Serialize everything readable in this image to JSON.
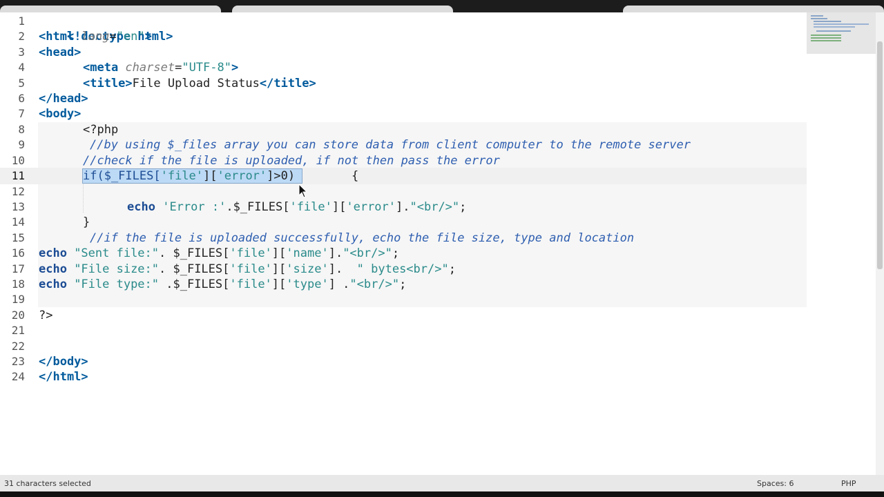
{
  "gutter": [
    "1",
    "2",
    "3",
    "4",
    "5",
    "6",
    "7",
    "8",
    "9",
    "10",
    "11",
    "12",
    "13",
    "14",
    "15",
    "16",
    "17",
    "18",
    "19",
    "20",
    "21",
    "22",
    "23",
    "24"
  ],
  "code": {
    "l1": "<!doctype html>",
    "l2_open": "<html ",
    "l2_attr": "lang",
    "l2_eq": "=",
    "l2_val": "\"en\"",
    "l2_close": ">",
    "l3": "<head>",
    "l4_open": "<meta ",
    "l4_attr": "charset",
    "l4_eq": "=",
    "l4_val": "\"UTF-8\"",
    "l4_close": ">",
    "l5_open": "<title>",
    "l5_text": "File Upload Status",
    "l5_close": "</title>",
    "l6": "</head>",
    "l7": "<body>",
    "l8": "<?php",
    "l9": "//by using $_files array you can store data from client computer to the remote server",
    "l10": "//check if the file is uploaded, if not then pass the error",
    "l11_sel_a": "if($_FILES[",
    "l11_sel_b": "'file'",
    "l11_sel_c": "][",
    "l11_sel_d": "'error'",
    "l11_sel_e": "]>0) ",
    "l11_rest": "       {",
    "l13_kw": "echo",
    "l13_a": " ",
    "l13_str1": "'Error :'",
    "l13_b": ".$_FILES[",
    "l13_str2": "'file'",
    "l13_c": "][",
    "l13_str3": "'error'",
    "l13_d": "].",
    "l13_str4": "\"<br/>\"",
    "l13_e": ";",
    "l14": "}",
    "l15": "//if the file is uploaded successfully, echo the file size, type and location",
    "l16_kw": "echo",
    "l16_str1": " \"Sent file:\"",
    "l16_a": ". $_FILES[",
    "l16_str2": "'file'",
    "l16_b": "][",
    "l16_str3": "'name'",
    "l16_c": "].",
    "l16_str4": "\"<br/>\"",
    "l16_d": ";",
    "l17_kw": "echo",
    "l17_str1": " \"File size:\"",
    "l17_a": ". $_FILES[",
    "l17_str2": "'file'",
    "l17_b": "][",
    "l17_str3": "'size'",
    "l17_c": "].  ",
    "l17_str4": "\" bytes<br/>\"",
    "l17_d": ";",
    "l18_kw": "echo",
    "l18_str1": " \"File type:\"",
    "l18_a": " .$_FILES[",
    "l18_str2": "'file'",
    "l18_b": "][",
    "l18_str3": "'type'",
    "l18_c": "] .",
    "l18_str4": "\"<br/>\"",
    "l18_d": ";",
    "l20": "?>",
    "l23": "</body>",
    "l24": "</html>"
  },
  "status": {
    "selection": "31 characters selected",
    "indent": "Spaces: 6",
    "syntax": "PHP"
  }
}
